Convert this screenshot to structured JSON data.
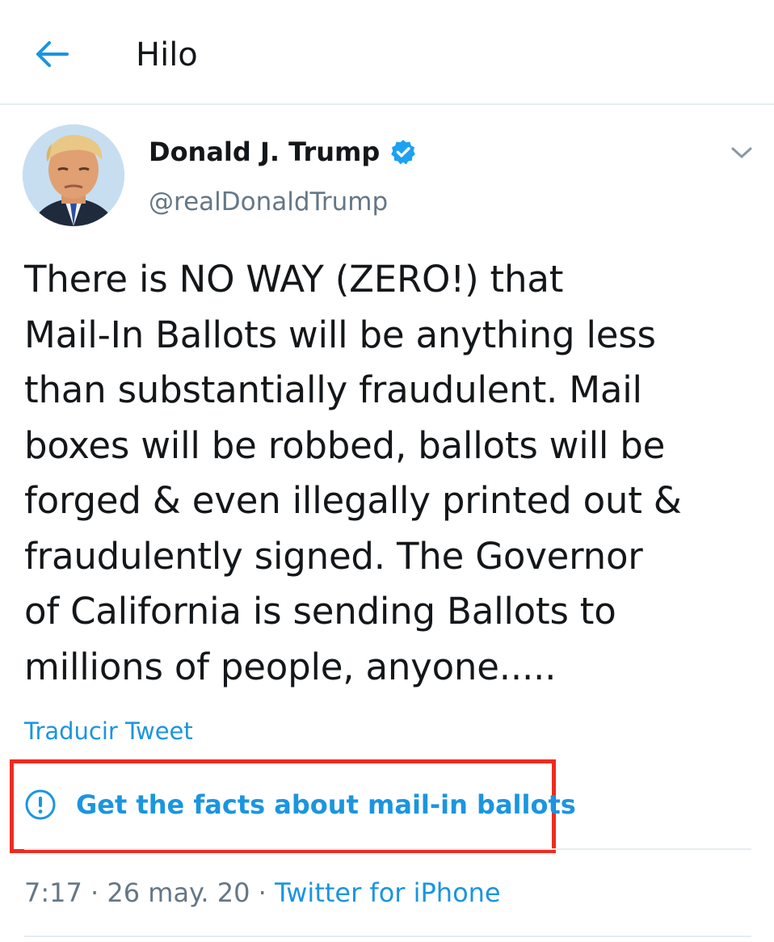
{
  "header": {
    "title": "Hilo",
    "back_icon": "arrow-left-icon"
  },
  "tweet": {
    "author_name": "Donald J. Trump",
    "author_handle": "@realDonaldTrump",
    "verified_icon": "verified-badge-icon",
    "caret_icon": "chevron-down-icon",
    "text": "There is NO WAY (ZERO!) that\nMail-In Ballots will be anything less\nthan substantially fraudulent. Mail\nboxes will be robbed, ballots will be\nforged & even illegally printed out &\nfraudulently signed. The Governor\nof California is sending Ballots to\nmillions of people, anyone.....",
    "translate_label": "Traducir Tweet",
    "facts_label": "Get the facts about mail-in ballots",
    "facts_icon": "exclamation-circle-icon",
    "time": "7:17",
    "date": "26 may. 20",
    "separator": "·",
    "source": "Twitter for iPhone"
  },
  "colors": {
    "accent": "#1b95e0",
    "highlight_box": "#ef2b1f",
    "muted": "#657786",
    "divider": "#e6ecf0"
  }
}
